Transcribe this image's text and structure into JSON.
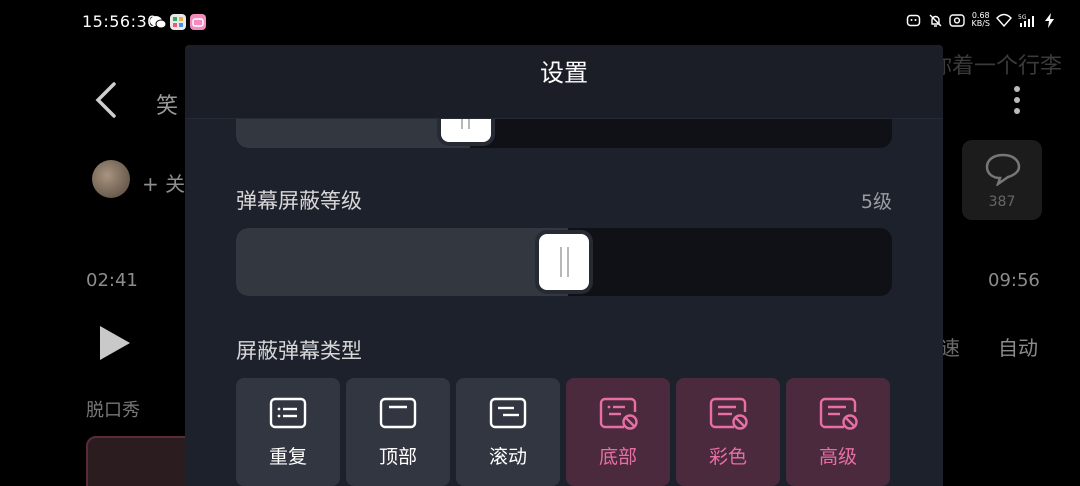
{
  "status_bar": {
    "time": "15:56:30",
    "net_speed_value": "0.68",
    "net_speed_unit": "KB/S",
    "signal": "5G"
  },
  "background": {
    "title": "笑",
    "marquee": "你着一个行李",
    "follow": "+ 关",
    "comment_count": "387",
    "time_current": "02:41",
    "time_total": "09:56",
    "speed_label": "速",
    "auto_label": "自动",
    "tag": "脱口秀"
  },
  "panel": {
    "title": "设置",
    "opacity_slider": {
      "level": 0.35
    },
    "block_level": {
      "label": "弹幕屏蔽等级",
      "value": "5级",
      "level": 0.5
    },
    "block_types": {
      "label": "屏蔽弹幕类型",
      "items": [
        {
          "label": "重复",
          "blocked": false
        },
        {
          "label": "顶部",
          "blocked": false
        },
        {
          "label": "滚动",
          "blocked": false
        },
        {
          "label": "底部",
          "blocked": true
        },
        {
          "label": "彩色",
          "blocked": true
        },
        {
          "label": "高级",
          "blocked": true
        }
      ]
    }
  },
  "colors": {
    "panel_bg": "#1d212b",
    "blocked_bg": "#4a2a3c",
    "blocked_accent": "#e86fa2",
    "normal_btn_bg": "#323640"
  }
}
